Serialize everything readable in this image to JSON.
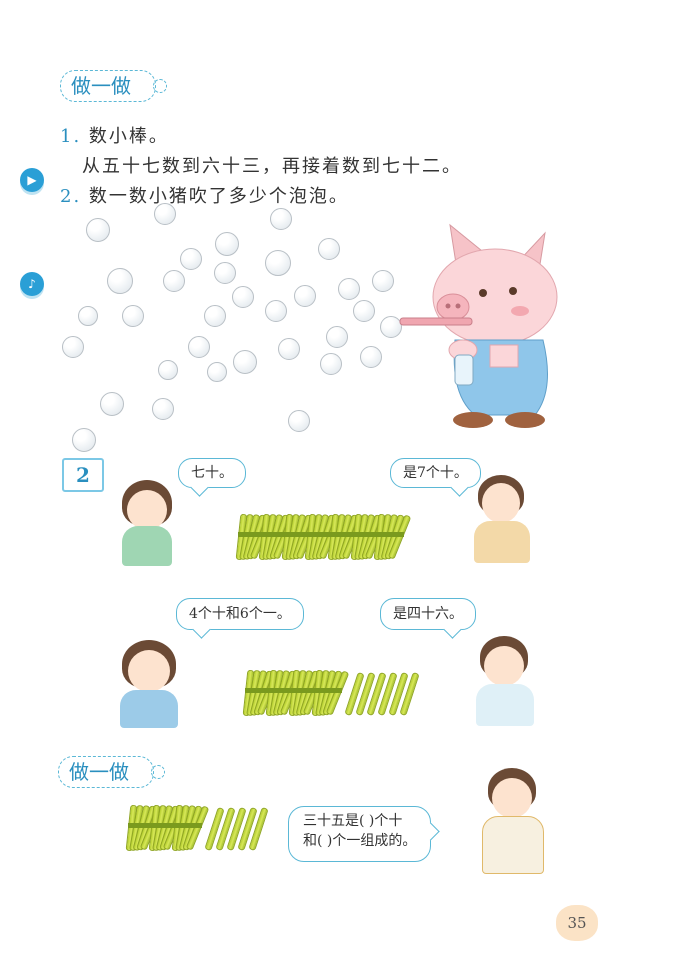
{
  "section1": {
    "title": "做一做",
    "items": [
      {
        "num": "1.",
        "text": "数小棒。",
        "subtext": "从五十七数到六十三，再接着数到七十二。"
      },
      {
        "num": "2.",
        "text": "数一数小猪吹了多少个泡泡。"
      }
    ]
  },
  "example2": {
    "number": "2",
    "scene1": {
      "girl_speech": "七十。",
      "boy_speech": "是7个十。",
      "bundles": 7,
      "singles": 0
    },
    "scene2": {
      "girl_speech": "4个十和6个一。",
      "boy_speech": "是四十六。",
      "bundles": 4,
      "singles": 6
    }
  },
  "section2": {
    "title": "做一做",
    "bundles": 3,
    "singles": 5,
    "speech_line1": "三十五是(    )个十",
    "speech_line2": "和(    )个一组成的。"
  },
  "page_number": "35",
  "colors": {
    "accent": "#2a8fbf",
    "stick": "#c6db3a",
    "page_badge": "#fbe3c6"
  }
}
